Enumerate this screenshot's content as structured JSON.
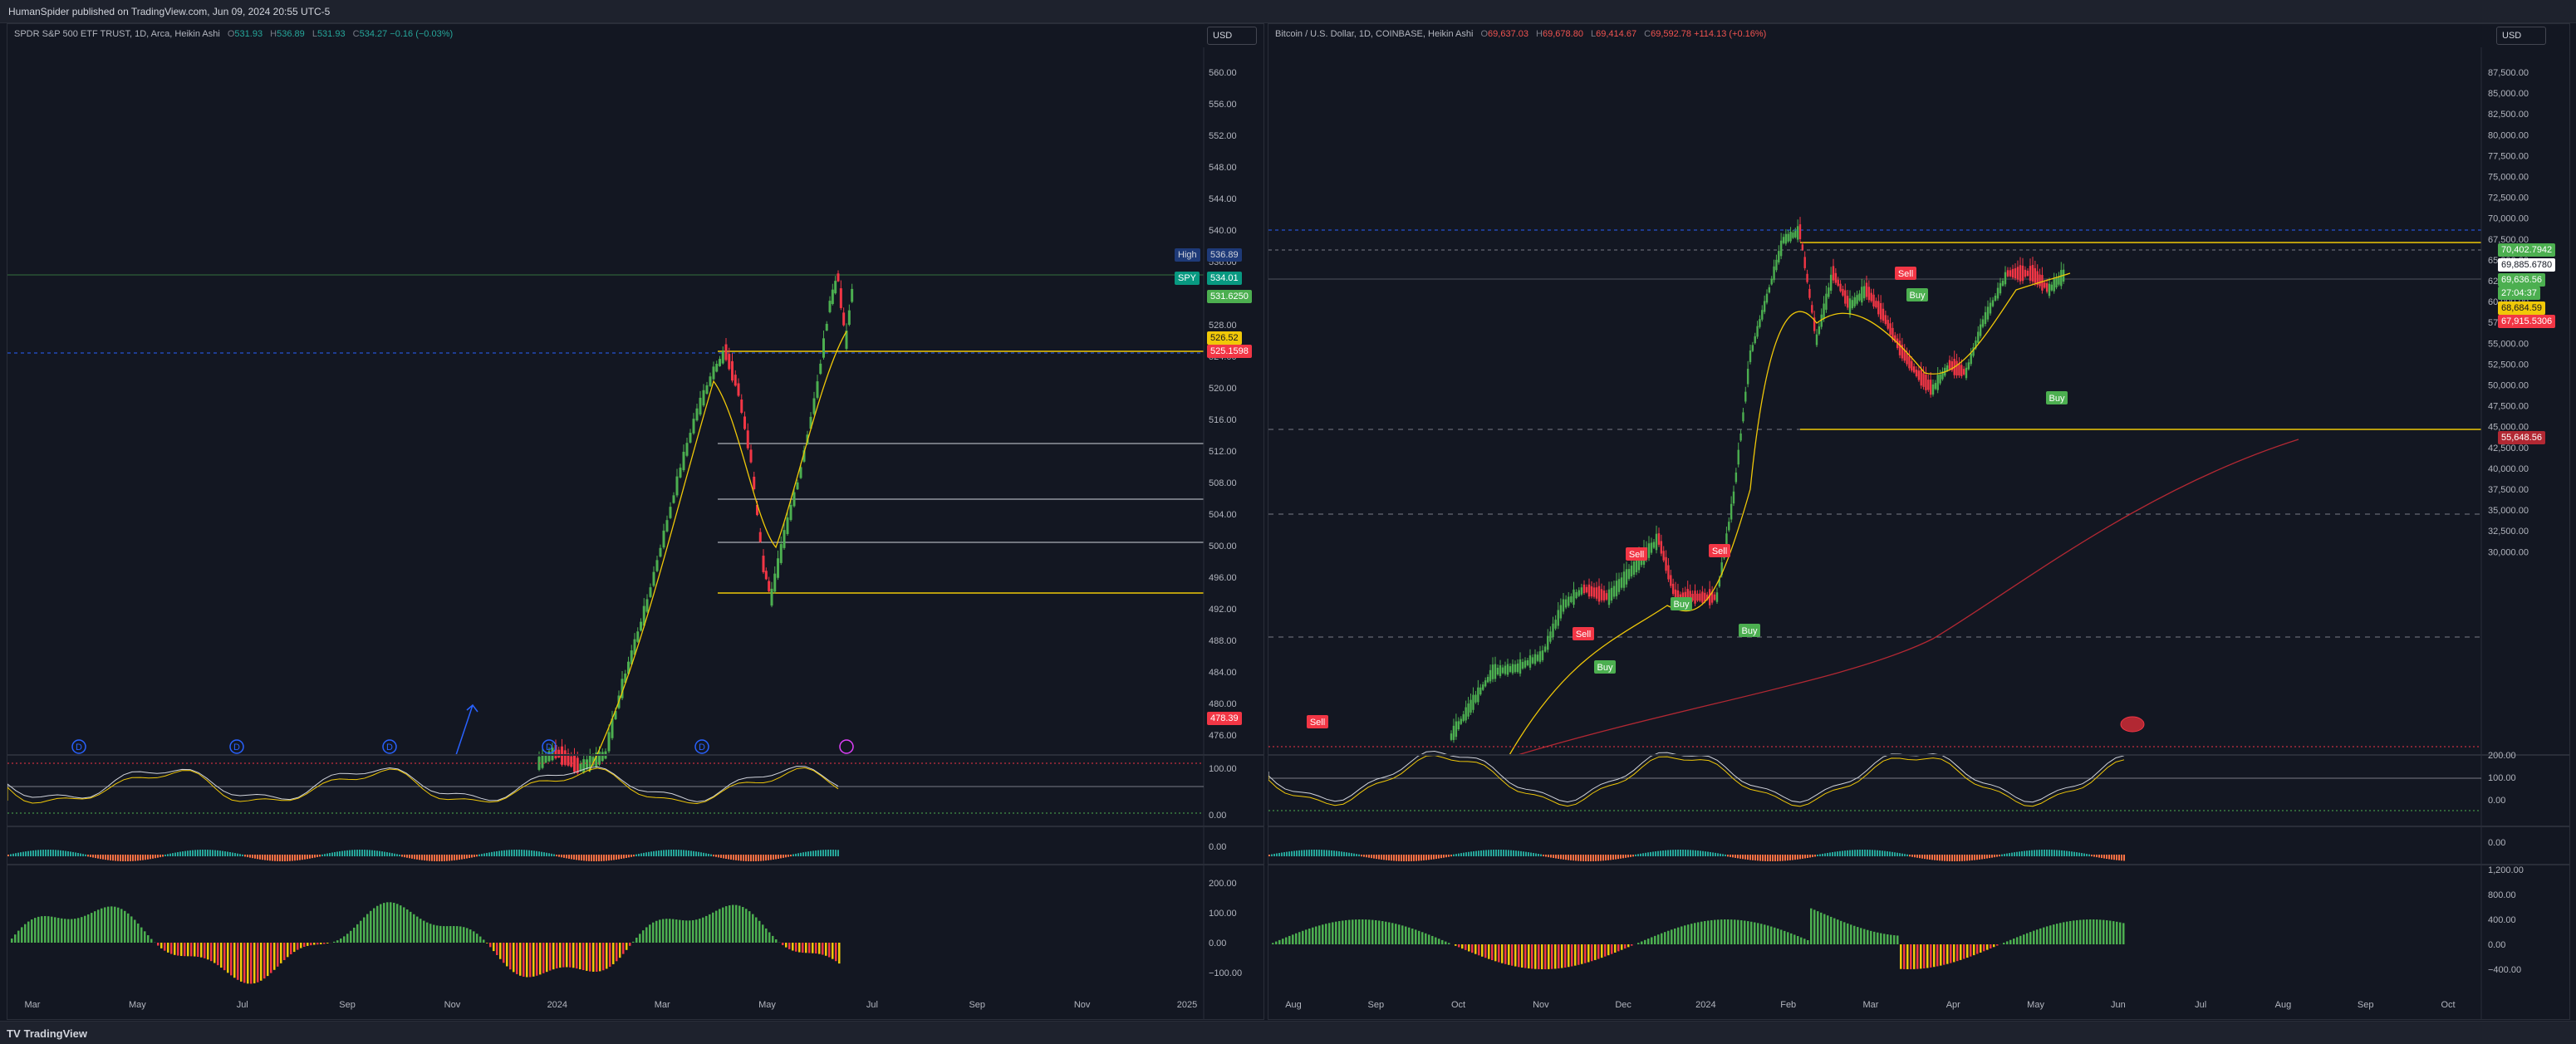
{
  "header": {
    "published": "HumanSpider published on TradingView.com, Jun 09, 2024 20:55 UTC-5"
  },
  "footer": {
    "brand": "TradingView",
    "brand_mark": "TV"
  },
  "left": {
    "title": "SPDR S&P 500 ETF TRUST, 1D, Arca, Heikin Ashi",
    "o": "531.93",
    "h": "536.89",
    "l": "531.93",
    "c": "534.27",
    "chg": "−0.16 (−0.03%)",
    "currency": "USD",
    "price_ticks": [
      "560.00",
      "556.00",
      "552.00",
      "548.00",
      "544.00",
      "540.00",
      "536.00",
      "532.00",
      "528.00",
      "524.00",
      "520.00",
      "516.00",
      "512.00",
      "508.00",
      "504.00",
      "500.00",
      "496.00",
      "492.00",
      "488.00",
      "484.00",
      "480.00",
      "476.00"
    ],
    "tags": {
      "high_label": "High",
      "high_value": "536.89",
      "sym_label": "SPY",
      "sym_value": "534.01",
      "green_value": "531.6250",
      "yellow_value": "526.52",
      "red_value": "525.1598",
      "low_value": "478.39"
    },
    "osc1_ticks": [
      "100.00",
      "0.00"
    ],
    "osc2_ticks": [
      "0.00"
    ],
    "osc3_ticks": [
      "200.00",
      "100.00",
      "0.00",
      "−100.00"
    ],
    "time_ticks": [
      "Mar",
      "May",
      "Jul",
      "Sep",
      "Nov",
      "2024",
      "Mar",
      "May",
      "Jul",
      "Sep",
      "Nov",
      "2025"
    ],
    "dividend_marker": "D"
  },
  "right": {
    "title": "Bitcoin / U.S. Dollar, 1D, COINBASE, Heikin Ashi",
    "o": "69,637.03",
    "h": "69,678.80",
    "l": "69,414.67",
    "c": "69,592.78",
    "chg": "+114.13 (+0.16%)",
    "currency": "USD",
    "price_ticks": [
      "87,500.00",
      "85,000.00",
      "82,500.00",
      "80,000.00",
      "77,500.00",
      "75,000.00",
      "72,500.00",
      "70,000.00",
      "67,500.00",
      "65,000.00",
      "62,500.00",
      "60,000.00",
      "57,500.00",
      "55,000.00",
      "52,500.00",
      "50,000.00",
      "47,500.00",
      "45,000.00",
      "42,500.00",
      "40,000.00",
      "37,500.00",
      "35,000.00",
      "32,500.00",
      "30,000.00"
    ],
    "tags": {
      "green_value": "70,402.7942",
      "white_value": "69,885.6780",
      "green2_value": "69,636.56",
      "green2_sub": "27:04:37",
      "yellow_value": "68,684.59",
      "red_value": "67,915.5306",
      "red2_value": "55,648.56"
    },
    "osc1_ticks": [
      "200.00",
      "100.00",
      "0.00"
    ],
    "osc2_ticks": [
      "0.00"
    ],
    "osc3_ticks": [
      "1,200.00",
      "800.00",
      "400.00",
      "0.00",
      "−400.00"
    ],
    "time_ticks": [
      "Aug",
      "Sep",
      "Oct",
      "Nov",
      "Dec",
      "2024",
      "Feb",
      "Mar",
      "Apr",
      "May",
      "Jun",
      "Jul",
      "Aug",
      "Sep",
      "Oct"
    ],
    "signals": [
      {
        "label": "Sell",
        "kind": "sell"
      },
      {
        "label": "Sell",
        "kind": "sell"
      },
      {
        "label": "Buy",
        "kind": "buy"
      },
      {
        "label": "Sell",
        "kind": "sell"
      },
      {
        "label": "Buy",
        "kind": "buy"
      },
      {
        "label": "Sell",
        "kind": "sell"
      },
      {
        "label": "Buy",
        "kind": "buy"
      },
      {
        "label": "Sell",
        "kind": "sell"
      },
      {
        "label": "Buy",
        "kind": "buy"
      },
      {
        "label": "Buy",
        "kind": "buy"
      }
    ]
  },
  "colors": {
    "bg": "#131722",
    "up": "#4caf50",
    "down": "#f23645",
    "yellow": "#f0c808",
    "grid": "#2a2e39",
    "text": "#b2b5be"
  }
}
